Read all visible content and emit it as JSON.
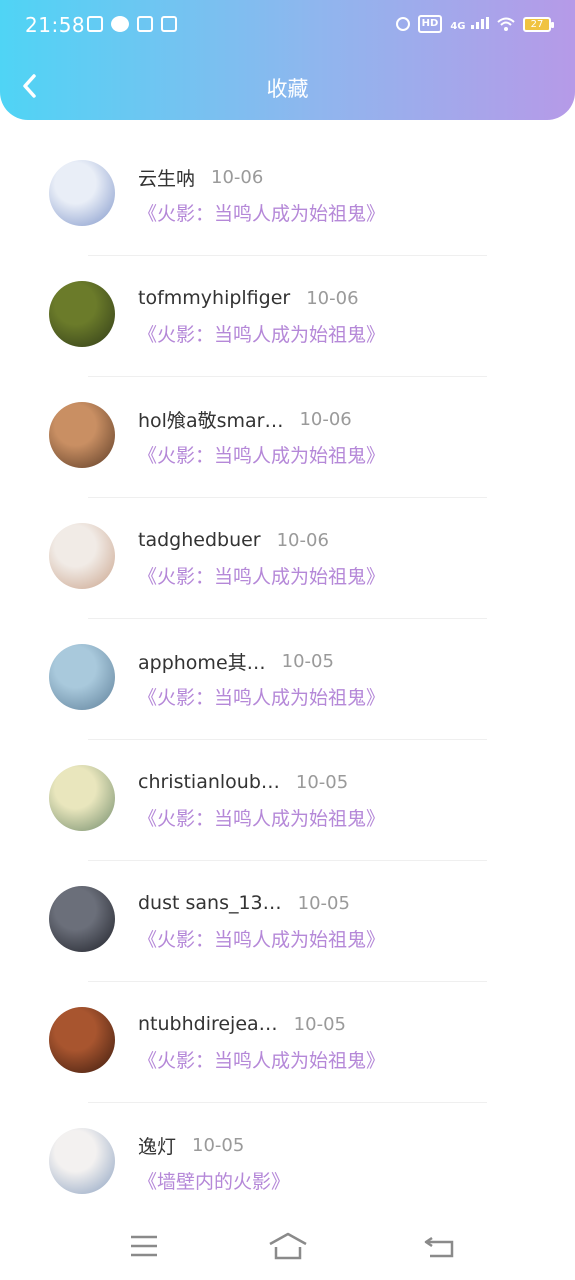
{
  "status_bar": {
    "time": "21:58",
    "network": "4G",
    "hd_label": "HD",
    "battery": "27"
  },
  "header": {
    "title": "收藏",
    "back_icon": "chevron-left-icon"
  },
  "items": [
    {
      "name": "云生呐",
      "date": "10-06",
      "book": "《火影：当鸣人成为始祖鬼》",
      "avatar_colors": [
        "#e9eef7",
        "#7f95c9"
      ]
    },
    {
      "name": "tofmmyhiplfiger",
      "date": "10-06",
      "book": "《火影：当鸣人成为始祖鬼》",
      "avatar_colors": [
        "#6b7b2a",
        "#2f3a18"
      ]
    },
    {
      "name": "hol飧a敬smar…",
      "date": "10-06",
      "book": "《火影：当鸣人成为始祖鬼》",
      "avatar_colors": [
        "#c98f63",
        "#5a3a25"
      ]
    },
    {
      "name": "tadghedbuer",
      "date": "10-06",
      "book": "《火影：当鸣人成为始祖鬼》",
      "avatar_colors": [
        "#f1ebe6",
        "#c9a28a"
      ]
    },
    {
      "name": "apphome其…",
      "date": "10-05",
      "book": "《火影：当鸣人成为始祖鬼》",
      "avatar_colors": [
        "#a9c9dc",
        "#5d7e98"
      ]
    },
    {
      "name": "christianloub…",
      "date": "10-05",
      "book": "《火影：当鸣人成为始祖鬼》",
      "avatar_colors": [
        "#e9e6bd",
        "#6f8a6a"
      ]
    },
    {
      "name": "dust sans_13…",
      "date": "10-05",
      "book": "《火影：当鸣人成为始祖鬼》",
      "avatar_colors": [
        "#6b6f7a",
        "#1e2028"
      ]
    },
    {
      "name": "ntubhdirejea…",
      "date": "10-05",
      "book": "《火影：当鸣人成为始祖鬼》",
      "avatar_colors": [
        "#a8552f",
        "#3a1a0e"
      ]
    },
    {
      "name": "逸灯",
      "date": "10-05",
      "book": "《墙壁内的火影》",
      "avatar_colors": [
        "#f3f1f0",
        "#8aa0c0"
      ]
    }
  ],
  "navbar": {
    "menu_icon": "menu-icon",
    "home_icon": "home-icon",
    "back_icon": "return-icon"
  }
}
